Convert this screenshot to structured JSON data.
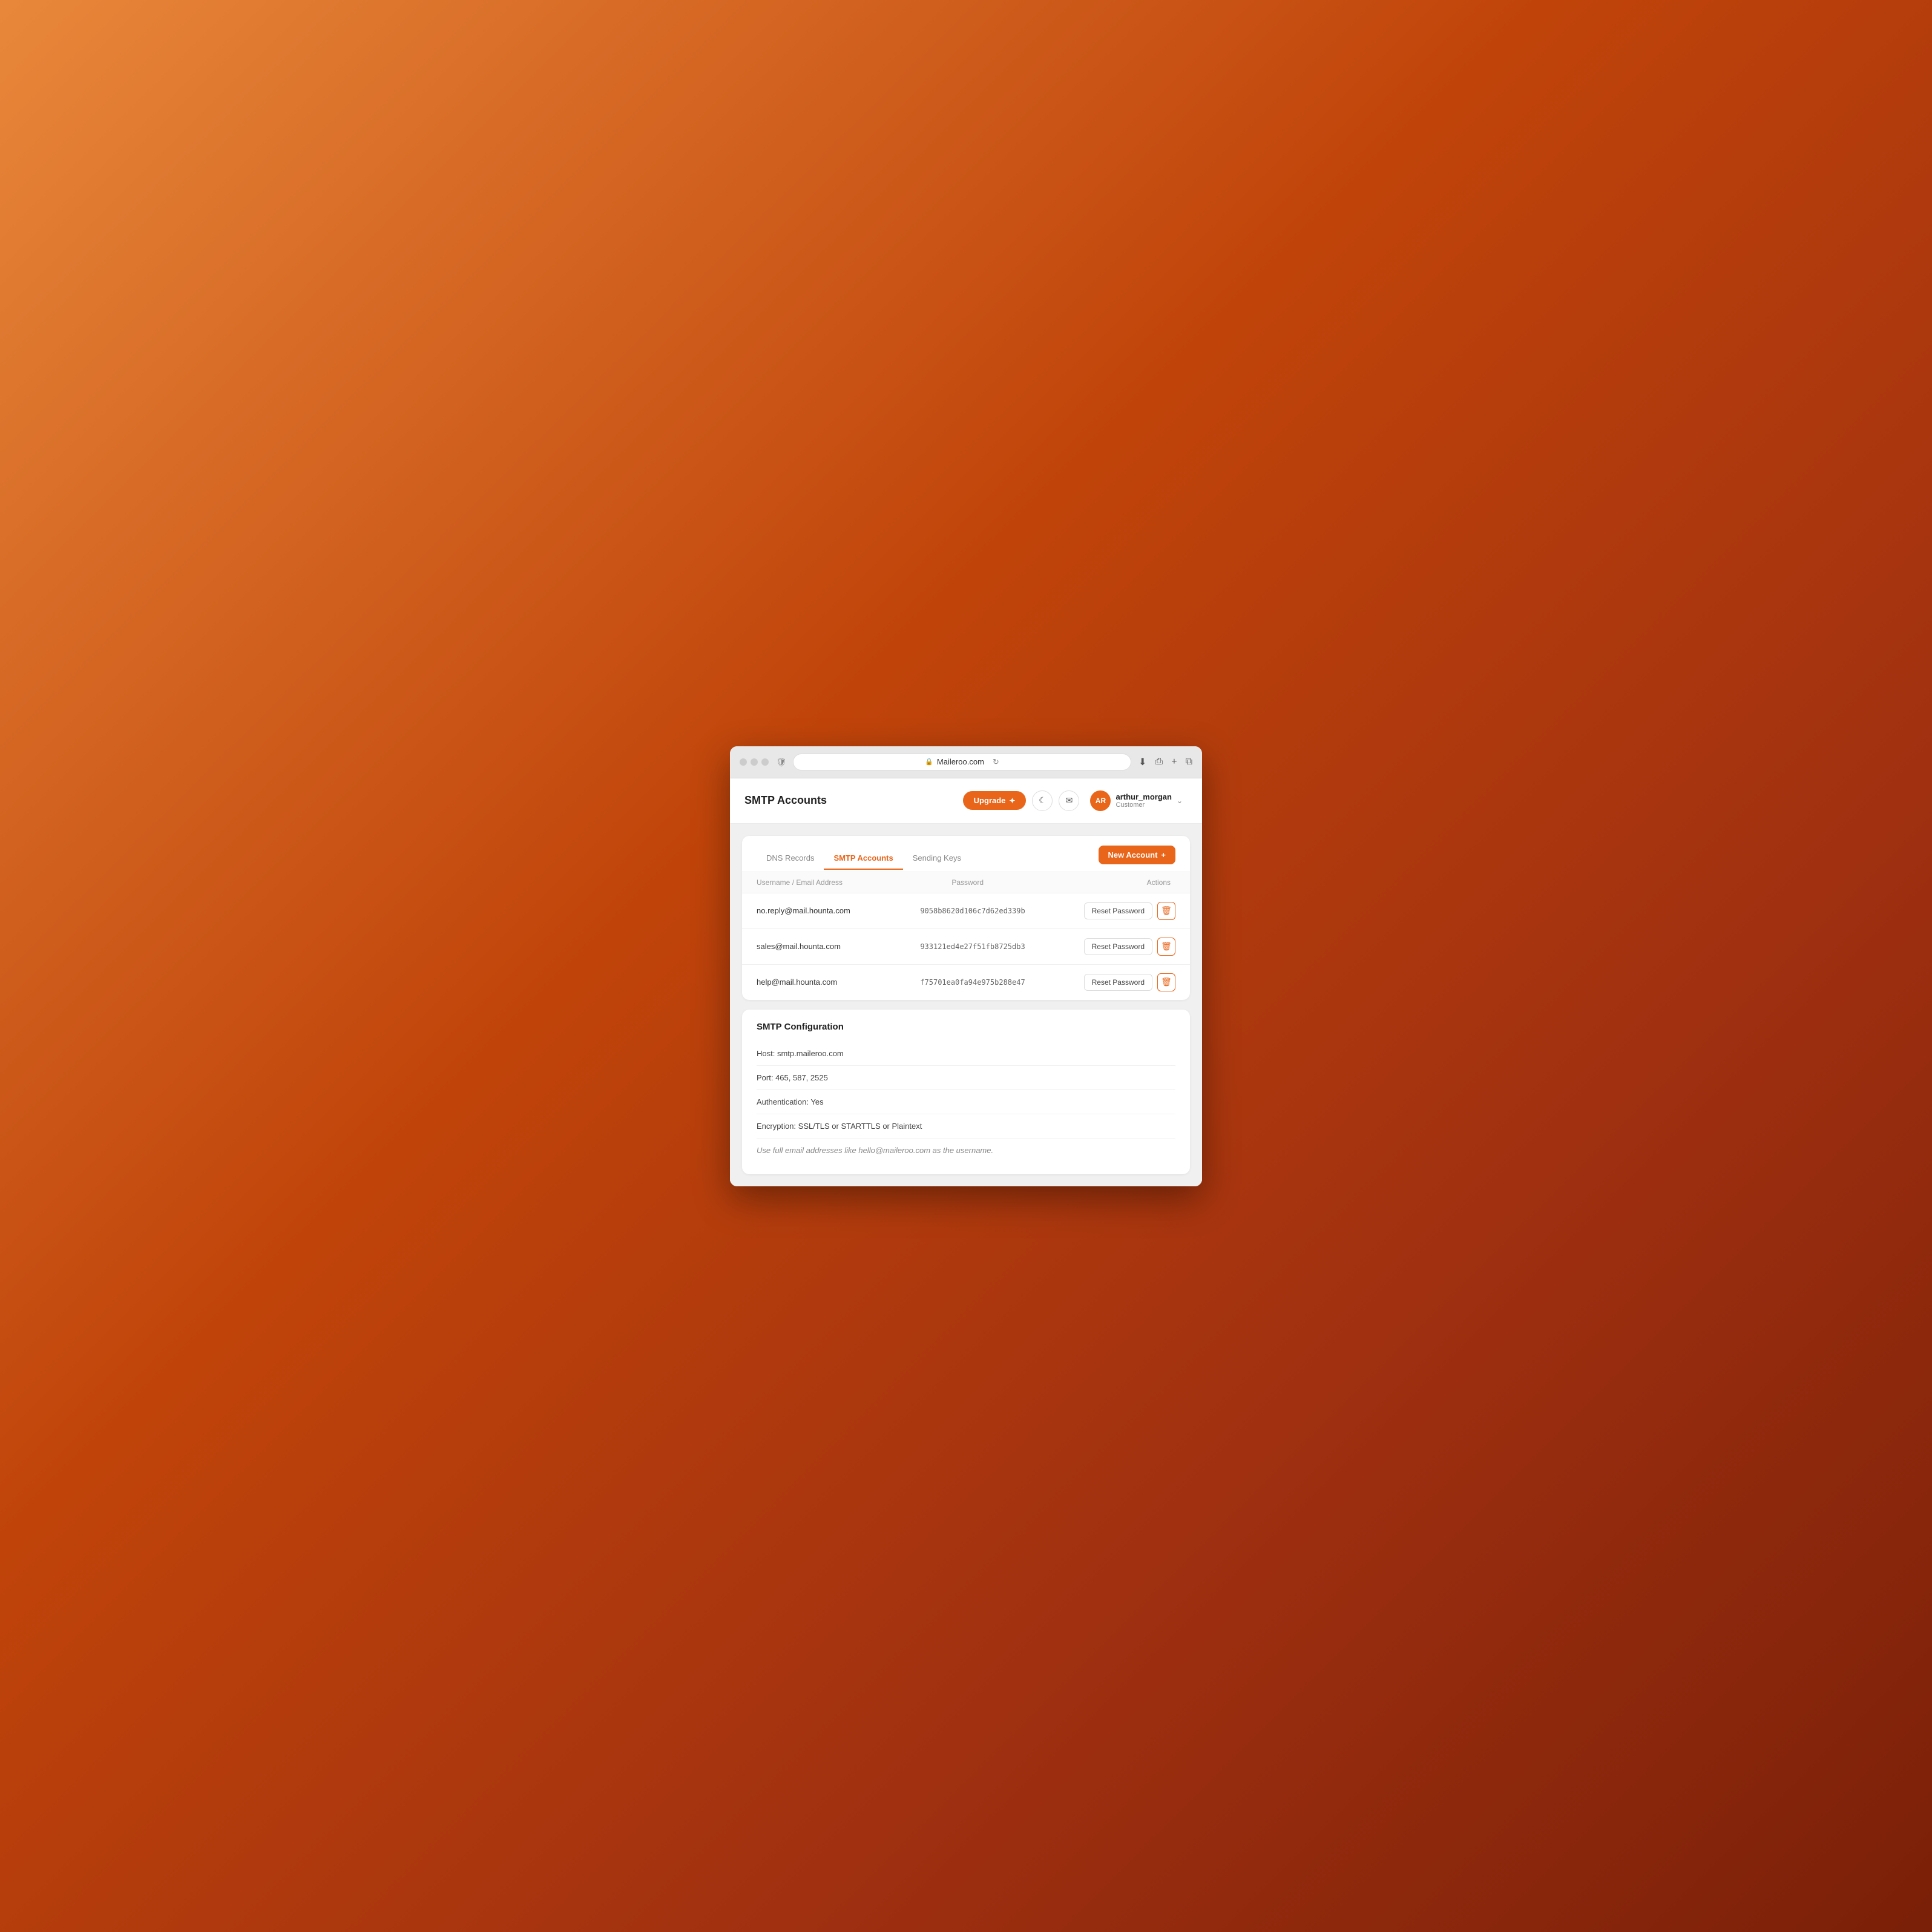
{
  "browser": {
    "url": "Maileroo.com",
    "lock_icon": "🔒",
    "refresh_icon": "↻"
  },
  "header": {
    "title": "SMTP Accounts",
    "upgrade_label": "Upgrade",
    "upgrade_icon": "✦",
    "moon_icon": "☾",
    "mail_icon": "✉",
    "avatar_initials": "AR",
    "username": "arthur_morgan",
    "role": "Customer",
    "chevron": "⌄"
  },
  "tabs": {
    "items": [
      {
        "label": "DNS Records",
        "active": false
      },
      {
        "label": "SMTP Accounts",
        "active": true
      },
      {
        "label": "Sending Keys",
        "active": false
      }
    ],
    "new_account_label": "New Account",
    "new_account_icon": "+"
  },
  "table": {
    "columns": [
      {
        "label": "Username / Email Address"
      },
      {
        "label": "Password"
      },
      {
        "label": "Actions"
      }
    ],
    "rows": [
      {
        "email": "no.reply@mail.hounta.com",
        "password": "9058b8620d106c7d62ed339b",
        "reset_label": "Reset Password",
        "delete_icon": "🗑"
      },
      {
        "email": "sales@mail.hounta.com",
        "password": "933121ed4e27f51fb8725db3",
        "reset_label": "Reset Password",
        "delete_icon": "🗑"
      },
      {
        "email": "help@mail.hounta.com",
        "password": "f75701ea0fa94e975b288e47",
        "reset_label": "Reset Password",
        "delete_icon": "🗑"
      }
    ]
  },
  "config": {
    "title": "SMTP Configuration",
    "items": [
      {
        "text": "Host: smtp.maileroo.com"
      },
      {
        "text": "Port: 465, 587, 2525"
      },
      {
        "text": "Authentication: Yes"
      },
      {
        "text": "Encryption: SSL/TLS or STARTTLS or Plaintext"
      },
      {
        "text": "Use full email addresses like hello@maileroo.com as the username.",
        "note": true
      }
    ]
  }
}
